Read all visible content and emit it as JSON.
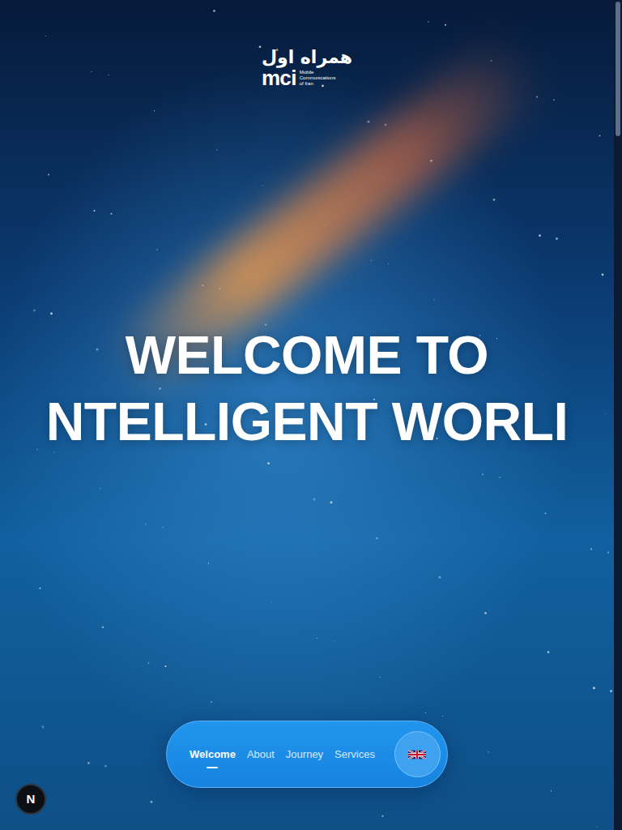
{
  "logo": {
    "persian": "همراه اول",
    "mark": "mci",
    "tagline": [
      "Mobile",
      "Communications",
      "of Iran"
    ]
  },
  "hero": {
    "lines": [
      "WELCOME TO",
      "NTELLIGENT WORLI"
    ]
  },
  "nav": {
    "items": [
      {
        "label": "Welcome",
        "selected": true
      },
      {
        "label": "About",
        "selected": false
      },
      {
        "label": "Journey",
        "selected": false
      },
      {
        "label": "Services",
        "selected": false
      }
    ]
  },
  "dev_indicator": {
    "label": "N"
  }
}
